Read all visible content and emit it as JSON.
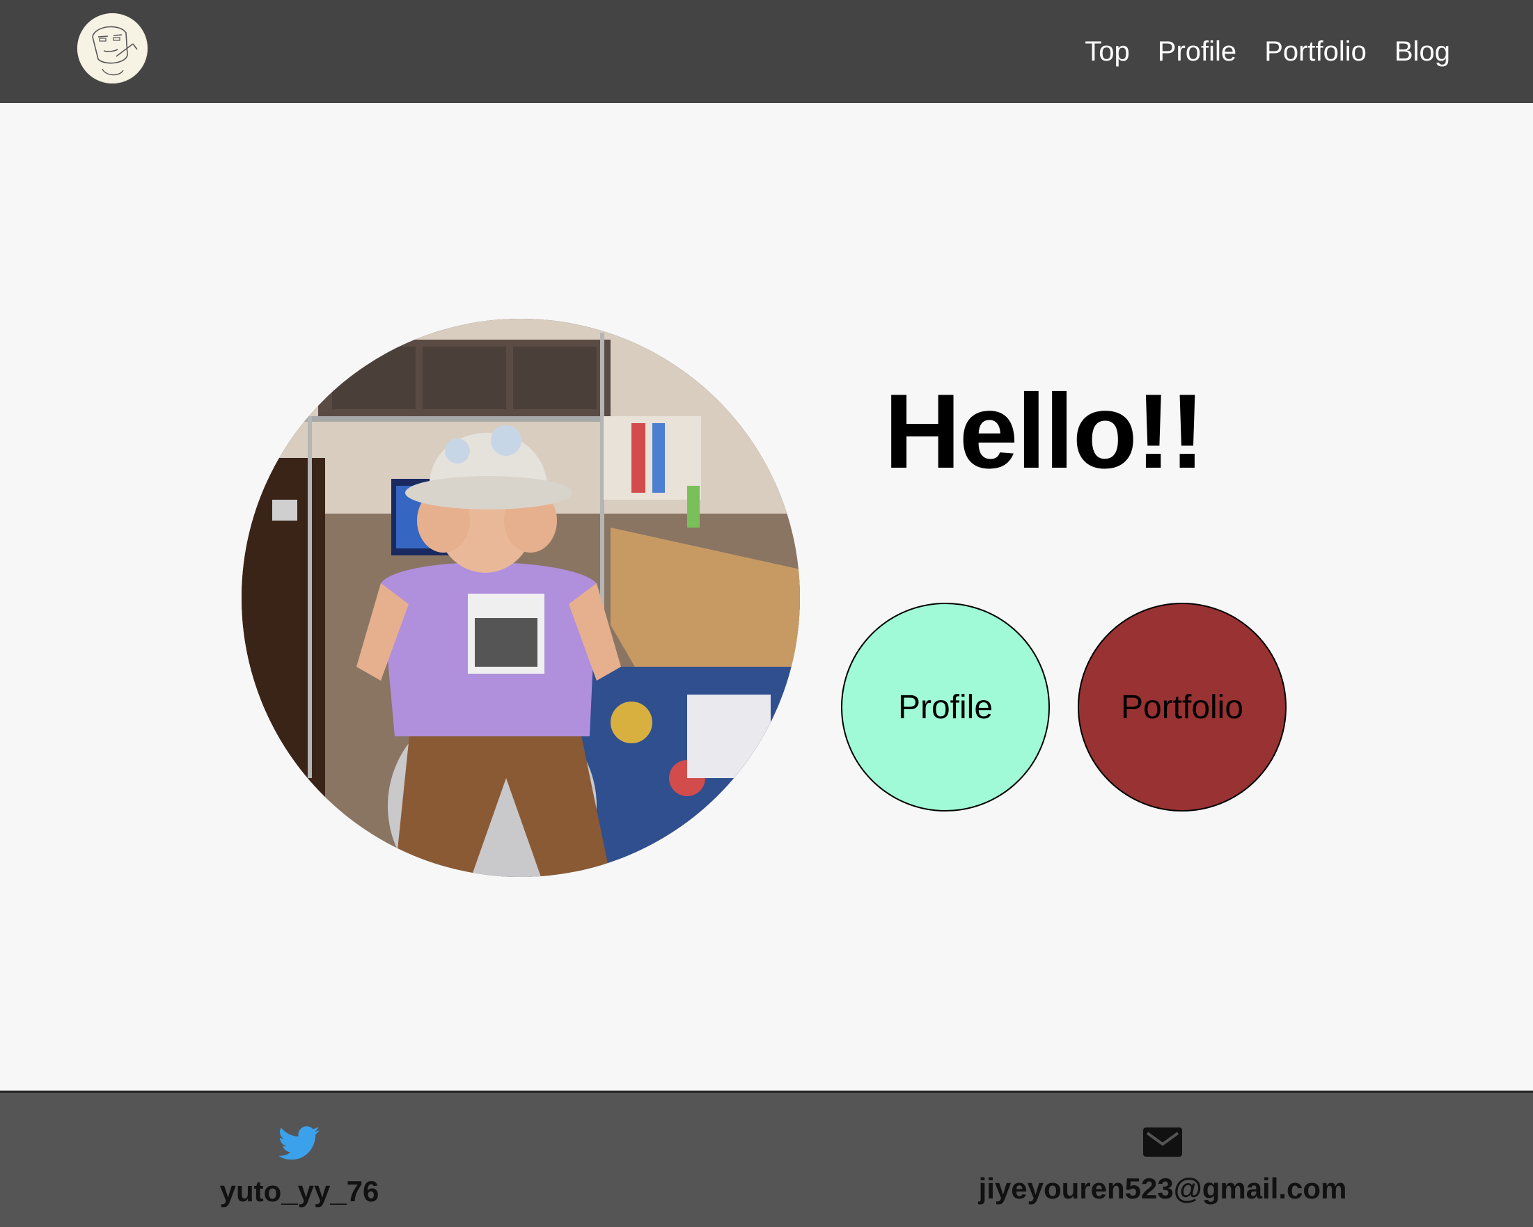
{
  "header": {
    "logo_icon": "cartoon-face-logo-icon",
    "nav": [
      {
        "label": "Top"
      },
      {
        "label": "Profile"
      },
      {
        "label": "Portfolio"
      },
      {
        "label": "Blog"
      }
    ]
  },
  "main": {
    "greeting": "Hello!!",
    "buttons": {
      "profile": "Profile",
      "portfolio": "Portfolio"
    },
    "photo_icon": "profile-photo",
    "colors": {
      "profile_button": "#a0fad7",
      "portfolio_button": "#993232"
    }
  },
  "footer": {
    "twitter": {
      "icon": "twitter-bird-icon",
      "handle": "yuto_yy_76",
      "color": "#3ba1ea"
    },
    "email": {
      "icon": "envelope-icon",
      "address": "jiyeyouren523@gmail.com"
    }
  }
}
